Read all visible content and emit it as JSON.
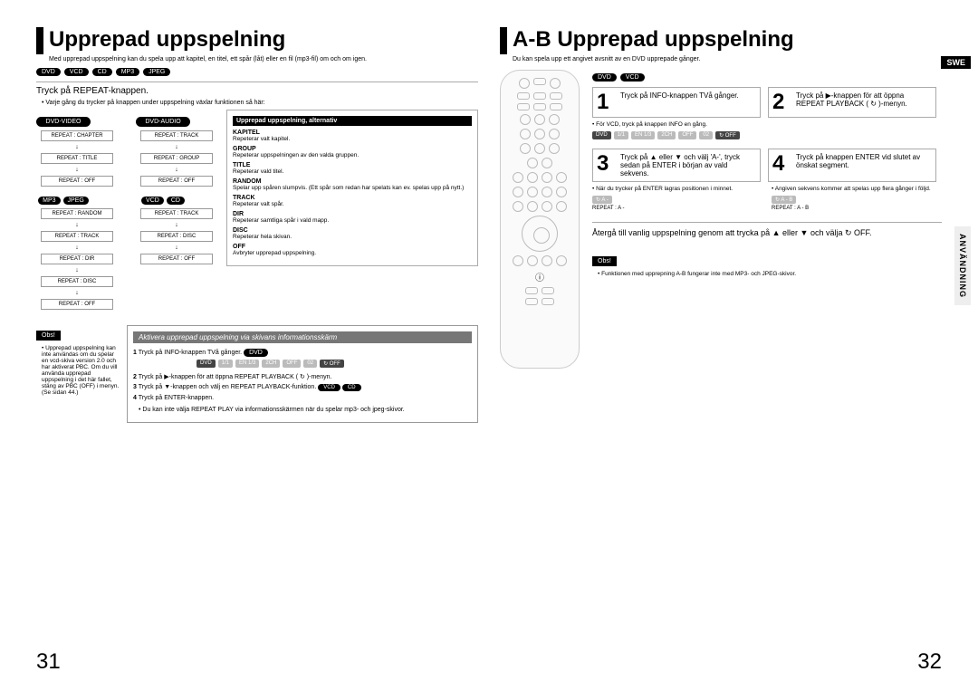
{
  "left": {
    "title": "Upprepad uppspelning",
    "sub": "Med upprepad uppspelning kan du spela upp att kapitel, en titel, ett spår (låt) eller en fil (mp3-fil) om och om igen.",
    "pills": [
      "DVD",
      "VCD",
      "CD",
      "MP3",
      "JPEG"
    ],
    "section": "Tryck på REPEAT-knappen.",
    "bullet": "Varje gång du trycker på knappen under uppspelning växlar funktionen så här:",
    "modes": {
      "dvdvideo": {
        "head": "DVD-VIDEO",
        "items": [
          "REPEAT : CHAPTER",
          "REPEAT : TITLE",
          "REPEAT : OFF"
        ]
      },
      "dvdaudio": {
        "head": "DVD-AUDIO",
        "items": [
          "REPEAT : TRACK",
          "REPEAT : GROUP",
          "REPEAT : OFF"
        ]
      },
      "mp3jpeg": {
        "head": [
          "MP3",
          "JPEG"
        ],
        "items": [
          "REPEAT : RANDOM",
          "REPEAT : TRACK",
          "REPEAT : DIR",
          "REPEAT : DISC",
          "REPEAT : OFF"
        ]
      },
      "vcdcd": {
        "head": [
          "VCD",
          "CD"
        ],
        "items": [
          "REPEAT : TRACK",
          "REPEAT : DISC",
          "REPEAT : OFF"
        ]
      }
    },
    "opts_title": "Upprepad uppspelning, alternativ",
    "opts": [
      {
        "k": "KAPITEL",
        "v": "Repeterar valt kapitel."
      },
      {
        "k": "GROUP",
        "v": "Repeterar uppspelningen av den valda gruppen."
      },
      {
        "k": "TITLE",
        "v": "Repeterar vald titel."
      },
      {
        "k": "RANDOM",
        "v": "Spelar upp spåren slumpvis. (Ett spår som redan har spelats kan ev. spelas upp på nytt.)"
      },
      {
        "k": "TRACK",
        "v": "Repeterar valt spår."
      },
      {
        "k": "DIR",
        "v": "Repeterar samtliga spår i vald mapp."
      },
      {
        "k": "DISC",
        "v": "Repeterar hela skivan."
      },
      {
        "k": "OFF",
        "v": "Avbryter upprepad uppspelning."
      }
    ],
    "info_head": "Aktivera upprepad uppspelning via skivans informationsskärm",
    "obs": "Obs!",
    "obs_text": "Upprepad uppspelning kan inte användas om du spelar en vcd-skiva version 2.0 och har aktiverat PBC. Om du vill använda upprepad uppspelning i det här fallet, stäng av PBC (OFF) i menyn. (Se sidan 44.)",
    "steps": [
      {
        "n": "1",
        "t": "Tryck på INFO-knappen TVå gånger.",
        "pill": "DVD"
      },
      {
        "n": "2",
        "t": "Tryck på ▶-knappen för att öppna REPEAT PLAYBACK ( ↻ )-menyn."
      },
      {
        "n": "3",
        "t": "Tryck på ▼-knappen och välj en REPEAT PLAYBACK-funktion.",
        "pill": "VCD CD"
      },
      {
        "n": "4",
        "t": "Tryck på ENTER-knappen."
      }
    ],
    "foot_bullet": "Du kan inte välja REPEAT PLAY via informationsskärmen när du spelar mp3- och jpeg-skivor.",
    "pagenum": "31"
  },
  "right": {
    "title": "A-B Upprepad uppspelning",
    "swe": "SWE",
    "sub": "Du kan spela upp ett angivet avsnitt av en DVD upprepade gånger.",
    "pills": [
      "DVD",
      "VCD"
    ],
    "steps": [
      {
        "n": "1",
        "t": "Tryck på INFO-knappen TVå gånger."
      },
      {
        "n": "2",
        "t": "Tryck på ▶-knappen för att öppna REPEAT PLAYBACK ( ↻ )-menyn."
      },
      {
        "n": "3",
        "t": "Tryck på ▲ eller ▼ och välj 'A-', tryck sedan på ENTER i början av vald sekvens."
      },
      {
        "n": "4",
        "t": "Tryck på knappen ENTER vid slutet av önskat segment."
      }
    ],
    "notes": [
      "För VCD, tryck på knappen INFO en gång.",
      "När du trycker på ENTER lagras positionen i minnet.",
      "Angiven sekvens kommer att spelas upp flera gånger i följd."
    ],
    "repeat_labels": [
      "REPEAT : A -",
      "REPEAT : A - B"
    ],
    "return_text": "Återgå till vanlig uppspelning genom att trycka på ▲ eller ▼ och välja ↻ OFF.",
    "obs": "Obs!",
    "obs_text": "Funktionen med upprepning A-B fungerar inte med MP3- och JPEG-skivor.",
    "sidebar": "ANVÄNDNING",
    "pagenum": "32"
  },
  "bar_segs": [
    "DVD",
    "1/1",
    "EN 1/3",
    "2CH",
    "OFF",
    "02",
    "↻ OFF"
  ]
}
